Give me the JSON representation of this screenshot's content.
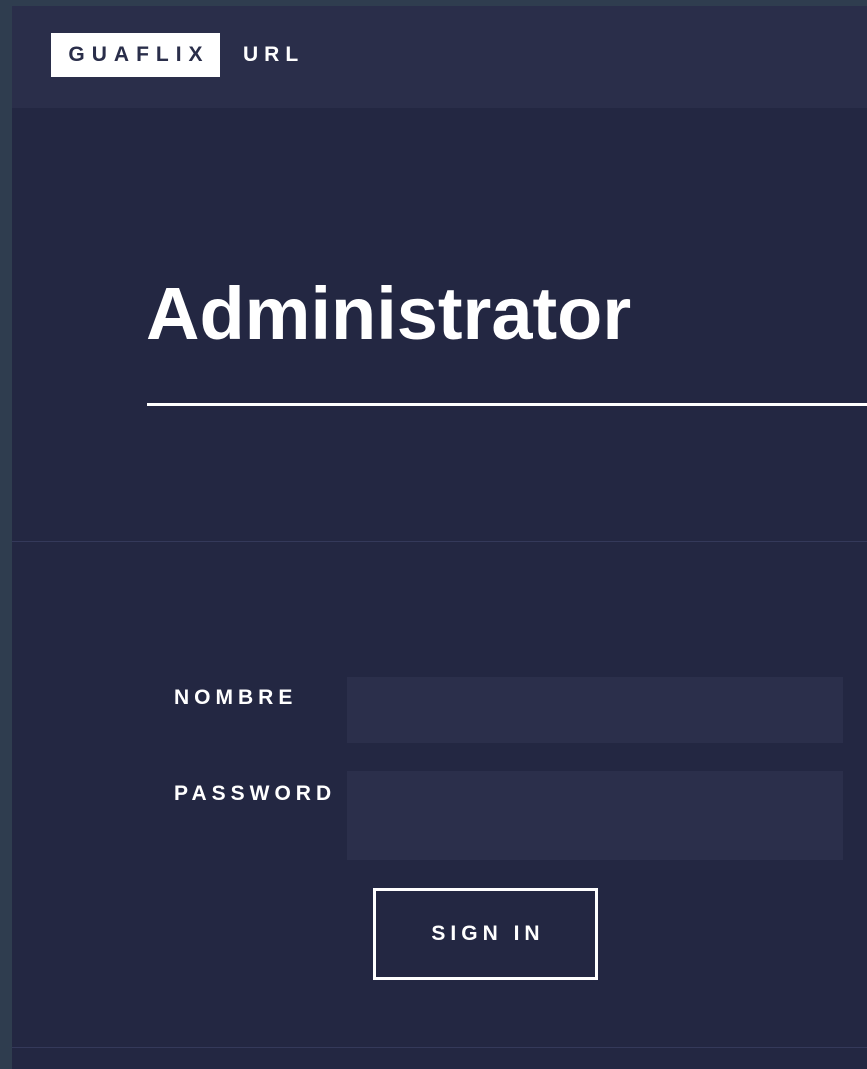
{
  "navbar": {
    "brand": "GUAFLIX",
    "link_label": "URL"
  },
  "hero": {
    "title": "Administrator"
  },
  "login_form": {
    "name_label": "NOMBRE",
    "name_value": "",
    "password_label": "PASSWORD",
    "password_value": "",
    "submit_label": "SIGN IN"
  },
  "colors": {
    "page_background": "#232742",
    "navbar_background": "#2a2e4a",
    "outer_frame": "#2f3d4f",
    "input_background": "#2b2f4b",
    "text": "#ffffff"
  }
}
